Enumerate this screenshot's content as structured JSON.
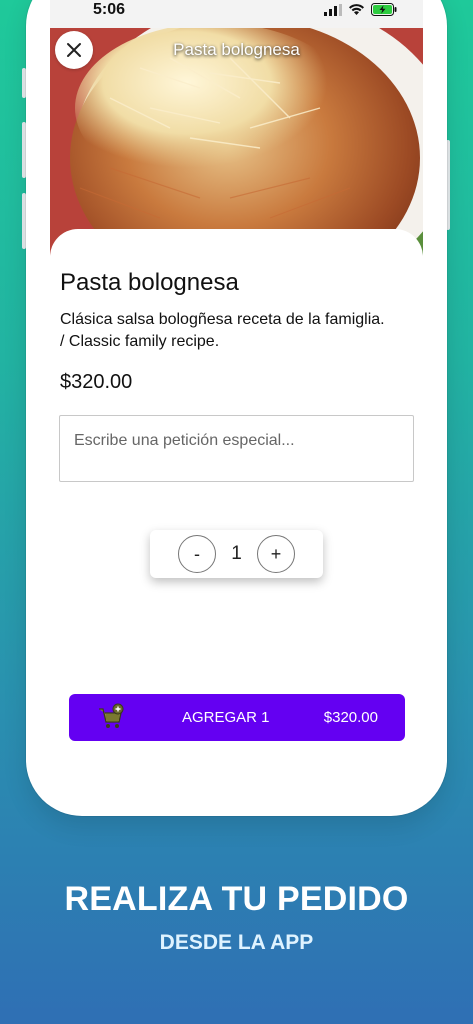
{
  "status_bar": {
    "time": "5:06"
  },
  "hero": {
    "title": "Pasta bolognesa"
  },
  "dish": {
    "name": "Pasta bolognesa",
    "description": "Clásica salsa bologñesa receta de la famiglia. / Classic family recipe.",
    "price": "$320.00"
  },
  "special_request": {
    "placeholder": "Escribe una petición especial...",
    "value": ""
  },
  "quantity": {
    "minus_label": "-",
    "value": "1",
    "plus_label": "+"
  },
  "add_button": {
    "label": "AGREGAR 1",
    "total": "$320.00",
    "color": "#6400f2"
  },
  "promo": {
    "title": "REALIZA TU PEDIDO",
    "subtitle": "DESDE LA APP"
  },
  "icons": {
    "close": "close-icon",
    "cart": "add-to-cart-icon",
    "signal": "signal-icon",
    "wifi": "wifi-icon",
    "battery": "battery-charging-icon"
  }
}
